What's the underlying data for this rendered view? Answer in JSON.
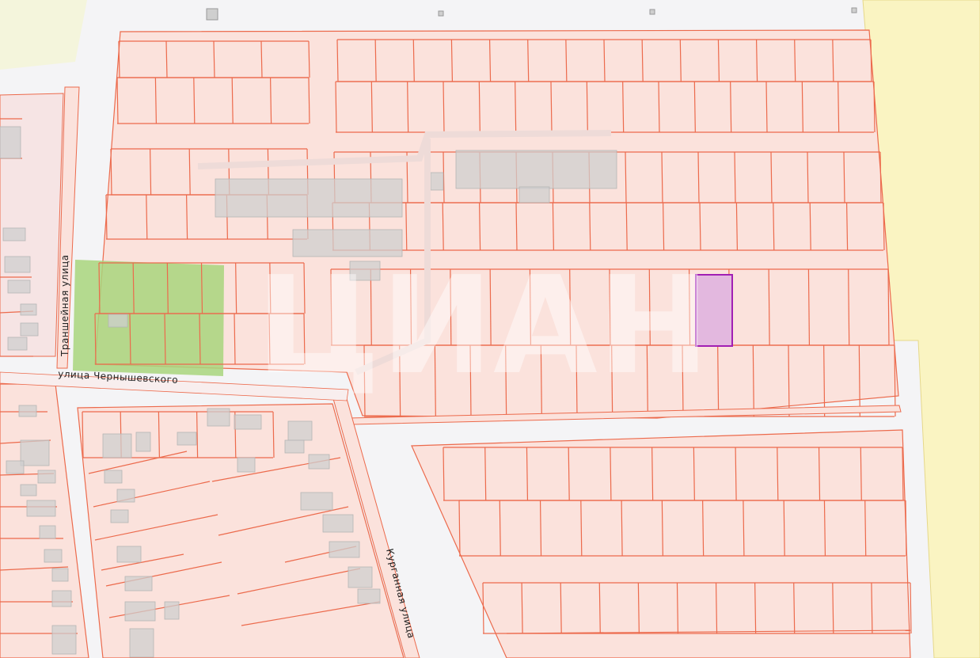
{
  "map": {
    "streets": [
      {
        "id": "chernyshevskogo",
        "name": "улица Чернышевского"
      },
      {
        "id": "transheynaya",
        "name": "Траншейная улица"
      },
      {
        "id": "kurgannaya",
        "name": "Курганная улица"
      }
    ],
    "watermark": "ЦИАН",
    "colors": {
      "parcel_fill": "#fbe2dc",
      "parcel_stroke": "#ec6a4c",
      "building_fill": "#cfcfcf",
      "selected_parcel_fill": "#e3b8df",
      "selected_parcel_stroke": "#a11fb4",
      "green_area": "#a8d57c",
      "yellow_zone": "#faf4c2",
      "background": "#f4f4f6"
    }
  }
}
